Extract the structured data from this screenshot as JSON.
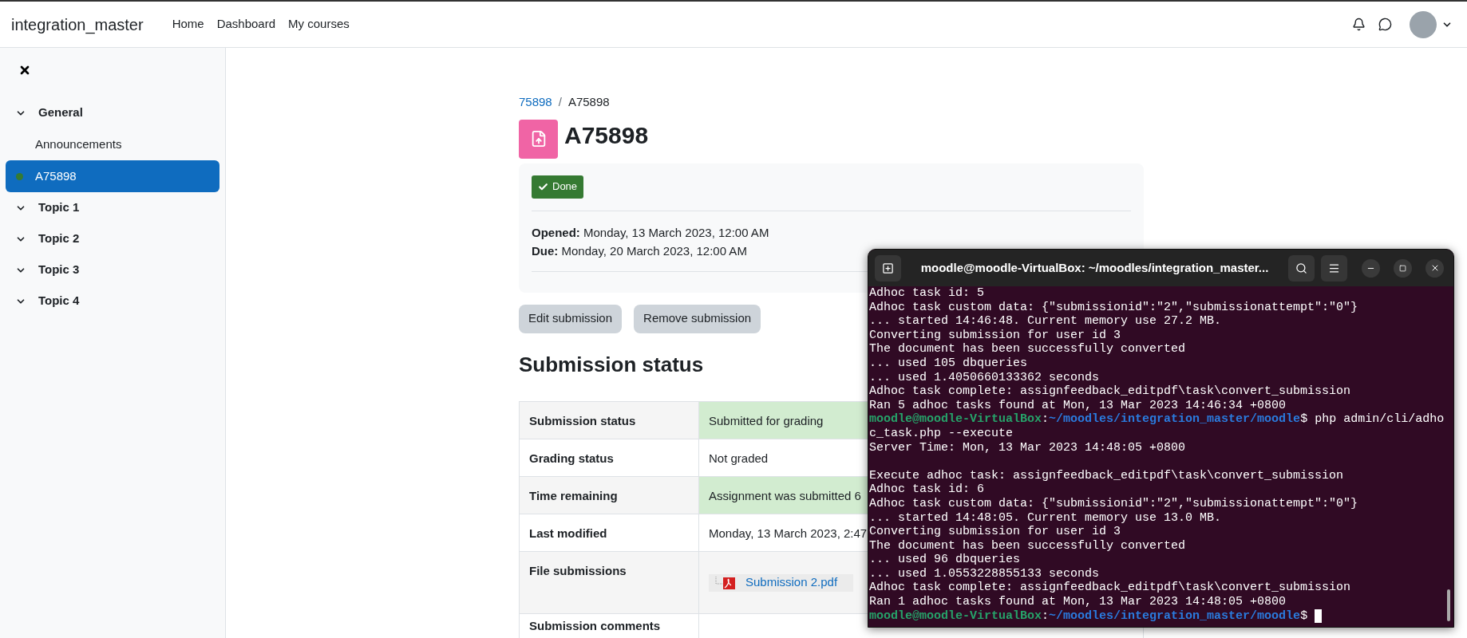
{
  "navbar": {
    "brand": "integration_master",
    "links": [
      {
        "label": "Home",
        "selected": false
      },
      {
        "label": "Dashboard",
        "selected": false
      },
      {
        "label": "My courses",
        "selected": false
      }
    ]
  },
  "sidebar": {
    "sections": [
      {
        "title": "General",
        "expanded": true,
        "children": [
          {
            "label": "Announcements",
            "selected": false,
            "completed": false
          },
          {
            "label": "A75898",
            "selected": true,
            "completed": true
          }
        ]
      },
      {
        "title": "Topic 1",
        "expanded": true
      },
      {
        "title": "Topic 2",
        "expanded": true
      },
      {
        "title": "Topic 3",
        "expanded": true
      },
      {
        "title": "Topic 4",
        "expanded": true
      }
    ]
  },
  "breadcrumb": {
    "separator": "/",
    "items": [
      {
        "label": "75898",
        "link": true
      },
      {
        "label": "A75898",
        "link": false
      }
    ]
  },
  "page_title": "A75898",
  "completion": {
    "label": "Done",
    "done": true
  },
  "dates": [
    "**Opened:** Monday, 13 March 2023, 12:00 AM",
    "**Due:** Monday, 20 March 2023, 12:00 AM"
  ],
  "actions": [
    "Edit submission",
    "Remove submission"
  ],
  "section_heading": "Submission status",
  "status_table": [
    {
      "label": "Submission status",
      "value": "Submitted for grading",
      "highlight": true,
      "kind": "text"
    },
    {
      "label": "Grading status",
      "value": "Not graded",
      "highlight": false,
      "kind": "text"
    },
    {
      "label": "Time remaining",
      "value": "Assignment was submitted 6",
      "highlight": true,
      "kind": "text"
    },
    {
      "label": "Last modified",
      "value": "Monday, 13 March 2023, 2:47",
      "highlight": false,
      "kind": "text"
    },
    {
      "label": "File submissions",
      "value": "Submission 2.pdf",
      "highlight": false,
      "kind": "file"
    },
    {
      "label": "Submission comments",
      "highlight": false,
      "kind": "empty"
    }
  ],
  "terminal": {
    "title": "moodle@moodle-VirtualBox: ~/moodles/integration_master...",
    "lines": [
      {
        "kind": "output",
        "text": "Adhoc task id: 5"
      },
      {
        "kind": "output",
        "text": "Adhoc task custom data: {\"submissionid\":\"2\",\"submissionattempt\":\"0\"}"
      },
      {
        "kind": "output",
        "text": "... started 14:46:48. Current memory use 27.2 MB."
      },
      {
        "kind": "output",
        "text": "Converting submission for user id 3"
      },
      {
        "kind": "output",
        "text": "The document has been successfully converted"
      },
      {
        "kind": "output",
        "text": "... used 105 dbqueries"
      },
      {
        "kind": "output",
        "text": "... used 1.4050660133362 seconds"
      },
      {
        "kind": "output",
        "text": "Adhoc task complete: assignfeedback_editpdf\\task\\convert_submission"
      },
      {
        "kind": "output",
        "text": "Ran 5 adhoc tasks found at Mon, 13 Mar 2023 14:46:34 +0800"
      },
      {
        "kind": "prompt",
        "user": "moodle@moodle-VirtualBox",
        "separator": ":",
        "path": "~/moodles/integration_master/moodle",
        "sign": "$",
        "command": " php admin/cli/adhoc_task.php --execute",
        "cursor": false
      },
      {
        "kind": "output",
        "text": "Server Time: Mon, 13 Mar 2023 14:48:05 +0800"
      },
      {
        "kind": "blank"
      },
      {
        "kind": "output",
        "text": "Execute adhoc task: assignfeedback_editpdf\\task\\convert_submission"
      },
      {
        "kind": "output",
        "text": "Adhoc task id: 6"
      },
      {
        "kind": "output",
        "text": "Adhoc task custom data: {\"submissionid\":\"2\",\"submissionattempt\":\"0\"}"
      },
      {
        "kind": "output",
        "text": "... started 14:48:05. Current memory use 13.0 MB."
      },
      {
        "kind": "output",
        "text": "Converting submission for user id 3"
      },
      {
        "kind": "output",
        "text": "The document has been successfully converted"
      },
      {
        "kind": "output",
        "text": "... used 96 dbqueries"
      },
      {
        "kind": "output",
        "text": "... used 1.0553228855133 seconds"
      },
      {
        "kind": "output",
        "text": "Adhoc task complete: assignfeedback_editpdf\\task\\convert_submission"
      },
      {
        "kind": "output",
        "text": "Ran 1 adhoc tasks found at Mon, 13 Mar 2023 14:48:05 +0800"
      },
      {
        "kind": "prompt",
        "user": "moodle@moodle-VirtualBox",
        "separator": ":",
        "path": "~/moodles/integration_master/moodle",
        "sign": "$",
        "cursor": true
      }
    ]
  }
}
